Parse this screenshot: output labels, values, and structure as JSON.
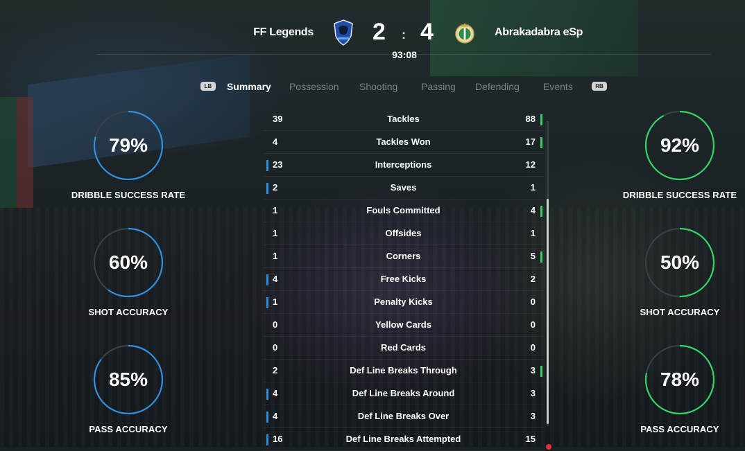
{
  "colors": {
    "home": "#2f8fe0",
    "away": "#34d36a",
    "ring_track": "#3a3f44"
  },
  "match": {
    "home_team": "FF Legends",
    "away_team": "Abrakadabra eSp",
    "home_score": "2",
    "away_score": "4",
    "separator": ":",
    "clock": "93:08",
    "home_crest_icon": "club-crest-icon",
    "away_crest_icon": "club-crest-icon"
  },
  "tabs": {
    "left_button": "LB",
    "right_button": "RB",
    "items": [
      "Summary",
      "Possession",
      "Shooting",
      "Passing",
      "Defending",
      "Events"
    ],
    "active": "Summary"
  },
  "home_rings": [
    {
      "value": "79%",
      "percent": 79,
      "label": "DRIBBLE SUCCESS RATE"
    },
    {
      "value": "60%",
      "percent": 60,
      "label": "SHOT ACCURACY"
    },
    {
      "value": "85%",
      "percent": 85,
      "label": "PASS ACCURACY"
    }
  ],
  "away_rings": [
    {
      "value": "92%",
      "percent": 92,
      "label": "DRIBBLE SUCCESS RATE"
    },
    {
      "value": "50%",
      "percent": 50,
      "label": "SHOT ACCURACY"
    },
    {
      "value": "78%",
      "percent": 78,
      "label": "PASS ACCURACY"
    }
  ],
  "stats": [
    {
      "name": "Tackles",
      "home": "39",
      "away": "88",
      "leader": "away"
    },
    {
      "name": "Tackles Won",
      "home": "4",
      "away": "17",
      "leader": "away"
    },
    {
      "name": "Interceptions",
      "home": "23",
      "away": "12",
      "leader": "home"
    },
    {
      "name": "Saves",
      "home": "2",
      "away": "1",
      "leader": "home"
    },
    {
      "name": "Fouls Committed",
      "home": "1",
      "away": "4",
      "leader": "away"
    },
    {
      "name": "Offsides",
      "home": "1",
      "away": "1",
      "leader": ""
    },
    {
      "name": "Corners",
      "home": "1",
      "away": "5",
      "leader": "away"
    },
    {
      "name": "Free Kicks",
      "home": "4",
      "away": "2",
      "leader": "home"
    },
    {
      "name": "Penalty Kicks",
      "home": "1",
      "away": "0",
      "leader": "home"
    },
    {
      "name": "Yellow Cards",
      "home": "0",
      "away": "0",
      "leader": ""
    },
    {
      "name": "Red Cards",
      "home": "0",
      "away": "0",
      "leader": ""
    },
    {
      "name": "Def Line Breaks Through",
      "home": "2",
      "away": "3",
      "leader": "away"
    },
    {
      "name": "Def Line Breaks Around",
      "home": "4",
      "away": "3",
      "leader": "home"
    },
    {
      "name": "Def Line Breaks Over",
      "home": "4",
      "away": "3",
      "leader": "home"
    },
    {
      "name": "Def Line Breaks Attempted",
      "home": "16",
      "away": "15",
      "leader": "home"
    }
  ]
}
